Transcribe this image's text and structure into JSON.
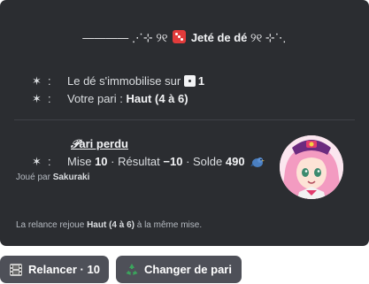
{
  "embed": {
    "header_left": "———— ⋰⊹ ୨୧ ",
    "title": "Jeté de dé",
    "header_right": " ୨୧ ⊹⋱",
    "rows": [
      {
        "bullet": "✶",
        "colon": ":",
        "label": "Le dé s'immobilise sur ",
        "value": "1"
      },
      {
        "bullet": "✶",
        "colon": ":",
        "label": "Votre pari : ",
        "value": "Haut (4 à 6)"
      }
    ],
    "result": {
      "title_prefix": "𝒫",
      "title": "ari perdu",
      "bullet": "✶",
      "colon": ":",
      "mise_label": "Mise ",
      "mise_value": "10",
      "sep1": " · Résultat ",
      "resultat_value": "−10",
      "sep2": " · Solde ",
      "solde_value": "490"
    },
    "played_by_label": "Joué par ",
    "played_by_user": "Sakuraki",
    "footer_prefix": "La relance rejoue ",
    "footer_bold": "Haut (4 à 6)",
    "footer_suffix": " à la même mise."
  },
  "buttons": [
    {
      "label": "Relancer · 10",
      "icon": "film-frames-icon"
    },
    {
      "label": "Changer de pari",
      "icon": "recycle-icon"
    }
  ],
  "colors": {
    "embed_bg": "#2b2d31",
    "button_bg": "#4e5058",
    "dice_red": "#e23b3b",
    "recycle_green": "#3ba55c"
  }
}
